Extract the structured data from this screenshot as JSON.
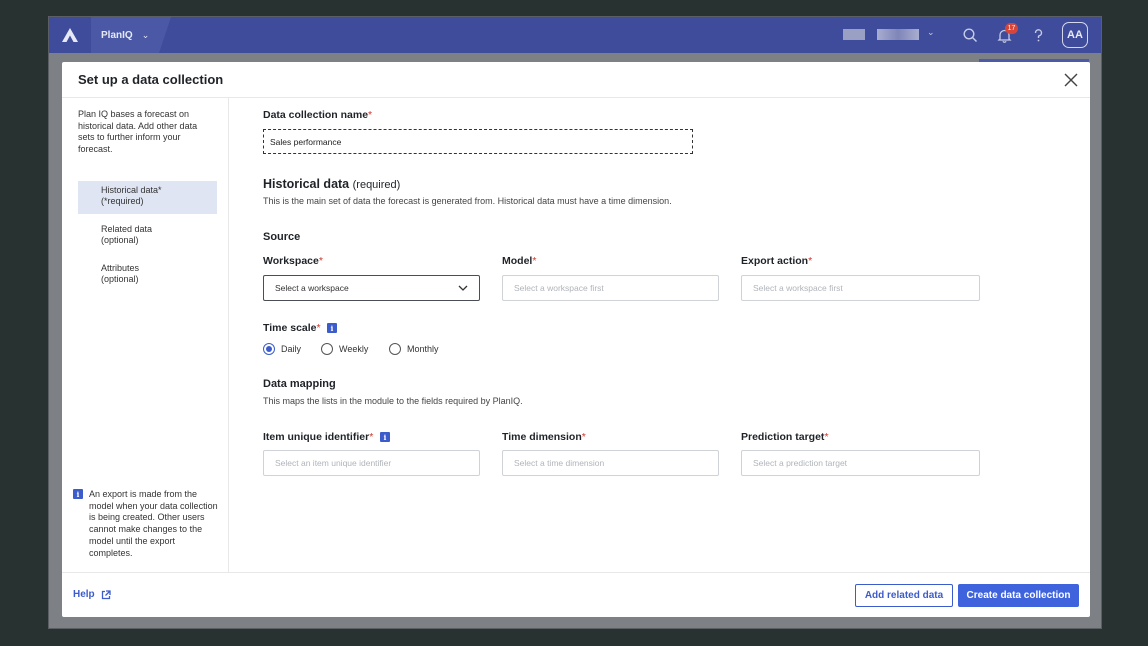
{
  "topbar": {
    "app_name": "PlanIQ",
    "notification_count": "17",
    "avatar_initials": "AA"
  },
  "modal": {
    "title": "Set up a data collection"
  },
  "sidebar": {
    "intro": "Plan IQ bases a forecast on historical data. Add other data sets to further inform your forecast.",
    "items": [
      {
        "line1": "Historical data*",
        "line2": "(*required)"
      },
      {
        "line1": "Related data",
        "line2": "(optional)"
      },
      {
        "line1": "Attributes",
        "line2": "(optional)"
      }
    ],
    "note": "An export is made from the model when your data collection is being created. Other users cannot make changes to the model until the export completes."
  },
  "form": {
    "name_label": "Data collection name",
    "name_value": "Sales performance",
    "historical_title": "Historical data",
    "historical_required": "(required)",
    "historical_desc": "This is the main set of data the forecast is generated from. Historical data must have a time dimension.",
    "source_title": "Source",
    "workspace_label": "Workspace",
    "workspace_value": "Select a workspace",
    "model_label": "Model",
    "model_placeholder": "Select a workspace first",
    "export_label": "Export action",
    "export_placeholder": "Select a workspace first",
    "timescale_label": "Time scale",
    "timescale_options": [
      "Daily",
      "Weekly",
      "Monthly"
    ],
    "timescale_selected": "Daily",
    "mapping_title": "Data mapping",
    "mapping_desc": "This maps the lists in the module to the fields required by PlanIQ.",
    "item_id_label": "Item unique identifier",
    "item_id_placeholder": "Select an item unique identifier",
    "time_dim_label": "Time dimension",
    "time_dim_placeholder": "Select a time dimension",
    "prediction_label": "Prediction target",
    "prediction_placeholder": "Select a prediction target",
    "required_mark": "*"
  },
  "footer": {
    "help_label": "Help",
    "add_related_label": "Add related data",
    "create_label": "Create data collection"
  },
  "colors": {
    "topbar": "#3f4c9b",
    "accent": "#3e63dd",
    "required": "#d0342c"
  }
}
